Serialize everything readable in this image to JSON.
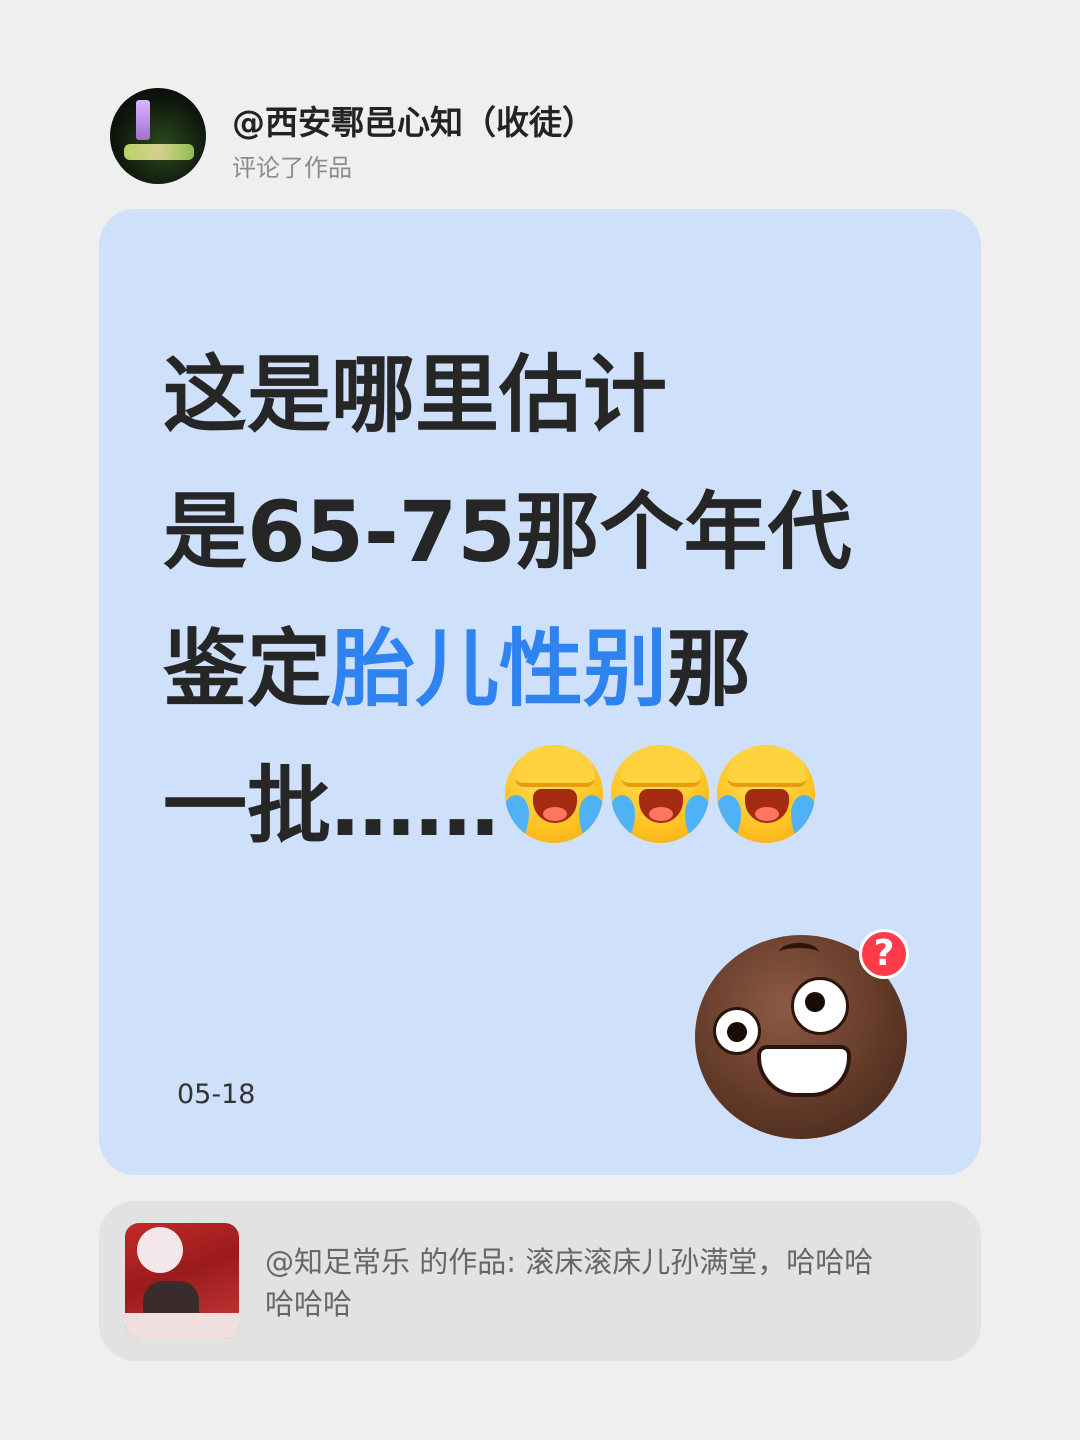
{
  "header": {
    "user_name": "@西安鄠邑心知（收徒）",
    "action": "评论了作品"
  },
  "comment": {
    "line1": "这是哪里估计",
    "line2": "是65-75那个年代",
    "line3_pre": "鉴定",
    "line3_highlight": "胎儿性别",
    "line3_post": "那",
    "line4": "一批……",
    "emojis": [
      "facepalm-crying-icon",
      "facepalm-crying-icon",
      "facepalm-crying-icon"
    ],
    "date": "05-18",
    "highlight_color": "#2f83ee",
    "sticker": "confused-face-icon"
  },
  "quote": {
    "text_line1": "@知足常乐 的作品: 滚床滚床儿孙满堂，哈哈哈",
    "text_line2": "哈哈哈"
  }
}
